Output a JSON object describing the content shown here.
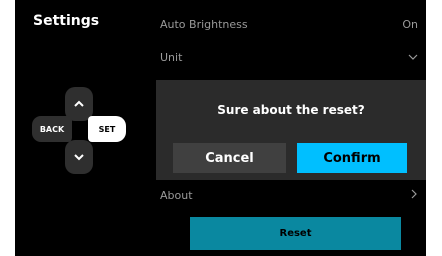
{
  "header": {
    "title": "Settings"
  },
  "dpad": {
    "back_label": "BACK",
    "set_label": "SET",
    "up_glyph": "^",
    "down_glyph": "v"
  },
  "menu": {
    "auto_brightness": {
      "label": "Auto Brightness",
      "value": "On"
    },
    "unit": {
      "label": "Unit",
      "icon": "chevron-down-icon"
    },
    "about": {
      "label": "About",
      "icon": "chevron-right-icon"
    }
  },
  "dialog": {
    "message": "Sure about the reset?",
    "cancel_label": "Cancel",
    "confirm_label": "Confirm"
  },
  "reset": {
    "label": "Reset"
  },
  "colors": {
    "accent": "#00bfff",
    "reset_bg": "#0a88a0",
    "screen_bg": "#000000",
    "dialog_bg": "#2b2b2b"
  }
}
